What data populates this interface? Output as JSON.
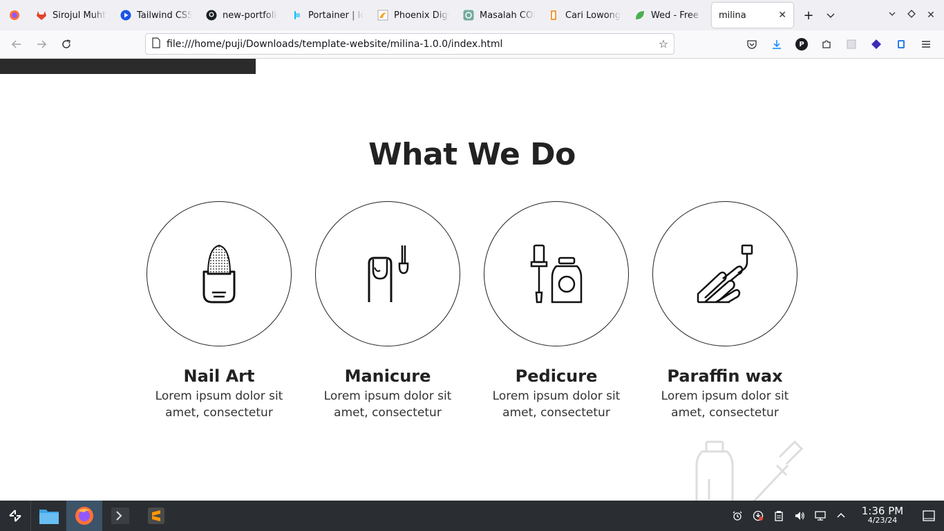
{
  "browser": {
    "tabs": [
      {
        "label": "Sirojul Muhta",
        "icon": "gitlab-icon"
      },
      {
        "label": "Tailwind CSS",
        "icon": "play-icon"
      },
      {
        "label": "new-portfolio",
        "icon": "github-icon"
      },
      {
        "label": "Portainer | lo",
        "icon": "portainer-icon"
      },
      {
        "label": "Phoenix Digi",
        "icon": "phoenix-icon"
      },
      {
        "label": "Masalah COR",
        "icon": "chatgpt-icon"
      },
      {
        "label": "Cari Lowonga",
        "icon": "job-icon"
      },
      {
        "label": "Wed - Free B",
        "icon": "leaf-icon"
      }
    ],
    "active_tab": "milina",
    "url": "file:///home/puji/Downloads/template-website/milina-1.0.0/index.html",
    "profile_letter": "P"
  },
  "page": {
    "heading": "What We Do",
    "services": [
      {
        "title": "Nail Art",
        "desc": "Lorem ipsum dolor sit amet, consectetur",
        "icon": "nail-art-icon"
      },
      {
        "title": "Manicure",
        "desc": "Lorem ipsum dolor sit amet, consectetur",
        "icon": "manicure-icon"
      },
      {
        "title": "Pedicure",
        "desc": "Lorem ipsum dolor sit amet, consectetur",
        "icon": "nail-polish-icon"
      },
      {
        "title": "Paraffin wax",
        "desc": "Lorem ipsum dolor sit amet, consectetur",
        "icon": "paraffin-wax-icon"
      }
    ]
  },
  "taskbar": {
    "time": "1:36 PM",
    "date": "4/23/24"
  }
}
